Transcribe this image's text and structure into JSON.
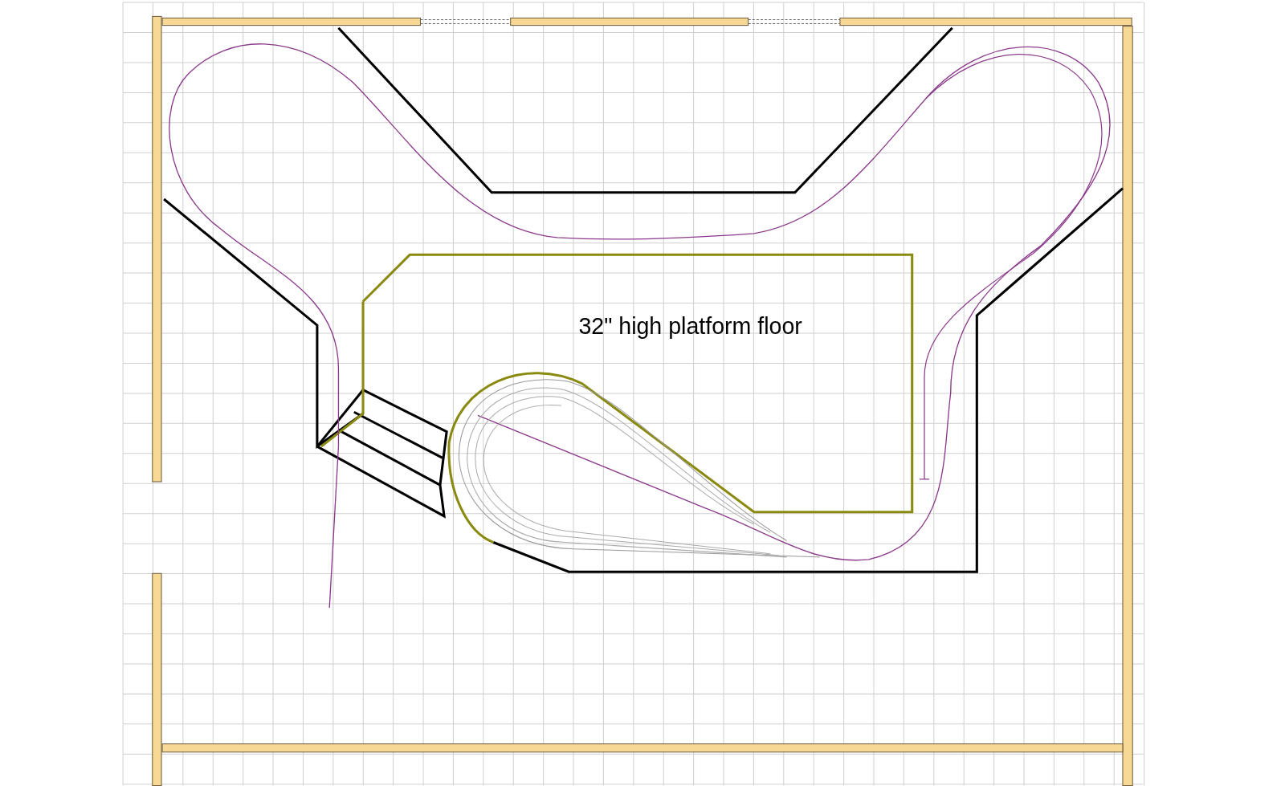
{
  "canvas": {
    "label": "32\" high platform floor"
  }
}
